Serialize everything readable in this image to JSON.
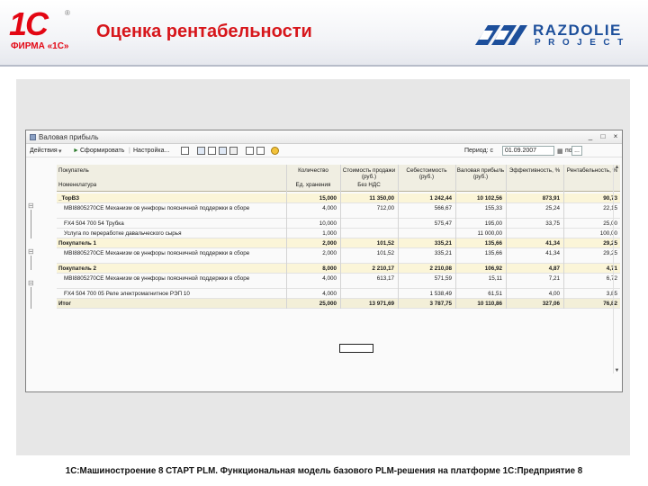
{
  "slide": {
    "brand_logo_text": "1С",
    "brand_reg": "®",
    "brand_firma": "ФИРМА «1С»",
    "title": "Оценка рентабельности",
    "partner_name": "RAZDOLIE",
    "partner_sub": "PROJECT",
    "footer": "1С:Машиностроение 8 СТАРТ PLM. Функциональная модель базового PLM-решения на платформе 1С:Предприятие 8"
  },
  "window": {
    "title": "Валовая прибыль",
    "toolbar": {
      "actions": "Действия",
      "generate": "Сформировать",
      "settings": "Настройка...",
      "period_label": "Период: с",
      "period_from": "01.09.2007",
      "period_to_label": "по"
    }
  },
  "table": {
    "headers": {
      "col1_line1": "Покупатель",
      "col1_line2": "Номенклатура",
      "qty_line1": "Количество",
      "qty_line2": "Ед. хранения",
      "sales_line1": "Стоимость продажи (руб.)",
      "sales_line2": "Без НДС",
      "cost": "Себестоимость (руб.)",
      "gross": "Валовая прибыль (руб.)",
      "eff": "Эффективность, %",
      "prof": "Рентабельность, %"
    },
    "rows": [
      {
        "type": "group",
        "name": "_ТорВЗ",
        "qty": "15,000",
        "sales": "11 350,00",
        "cost": "1 242,44",
        "gross": "10 102,56",
        "eff": "873,91",
        "prof": "90,73"
      },
      {
        "type": "item",
        "name": "MBI8805270CE Механизм ов уннфоры поясничной поддержки в сборе",
        "qty": "4,000",
        "sales": "712,00",
        "cost": "566,67",
        "gross": "155,33",
        "eff": "25,24",
        "prof": "22,15"
      },
      {
        "type": "item",
        "name": "FX4 504 700 54 Трубка",
        "qty": "10,000",
        "sales": "",
        "cost": "575,47",
        "gross": "195,00",
        "eff": "33,75",
        "prof": "25,00"
      },
      {
        "type": "item",
        "name": "Услуга по переработке давальческого сырья",
        "qty": "1,000",
        "sales": "",
        "cost": "",
        "gross": "11 000,00",
        "eff": "",
        "prof": "100,00"
      },
      {
        "type": "group",
        "name": "Покупатель 1",
        "qty": "2,000",
        "sales": "101,52",
        "cost": "335,21",
        "gross": "135,66",
        "eff": "41,34",
        "prof": "29,25"
      },
      {
        "type": "item",
        "name": "MBI8805270CE Механизм ов уннфоры поясничной поддержки в сборе",
        "qty": "2,000",
        "sales": "101,52",
        "cost": "335,21",
        "gross": "135,66",
        "eff": "41,34",
        "prof": "29,25"
      },
      {
        "type": "group",
        "name": "Покупатель 2",
        "qty": "8,000",
        "sales": "2 210,17",
        "cost": "2 210,08",
        "gross": "106,92",
        "eff": "4,87",
        "prof": "4,71"
      },
      {
        "type": "item",
        "name": "MBI8805270CE Механизм ов уннфоры поясничной поддержки в сборе",
        "qty": "4,000",
        "sales": "613,17",
        "cost": "571,59",
        "gross": "15,11",
        "eff": "7,21",
        "prof": "6,72"
      },
      {
        "type": "item",
        "name": "FX4 504 700 05 Реле электромагнитное РЭП 10",
        "qty": "4,000",
        "sales": "",
        "cost": "1 538,49",
        "gross": "61,51",
        "eff": "4,00",
        "prof": "3,85"
      },
      {
        "type": "total",
        "name": "Итог",
        "qty": "25,000",
        "sales": "13 971,69",
        "cost": "3 787,75",
        "gross": "10 110,86",
        "eff": "327,06",
        "prof": "76,82"
      }
    ]
  }
}
